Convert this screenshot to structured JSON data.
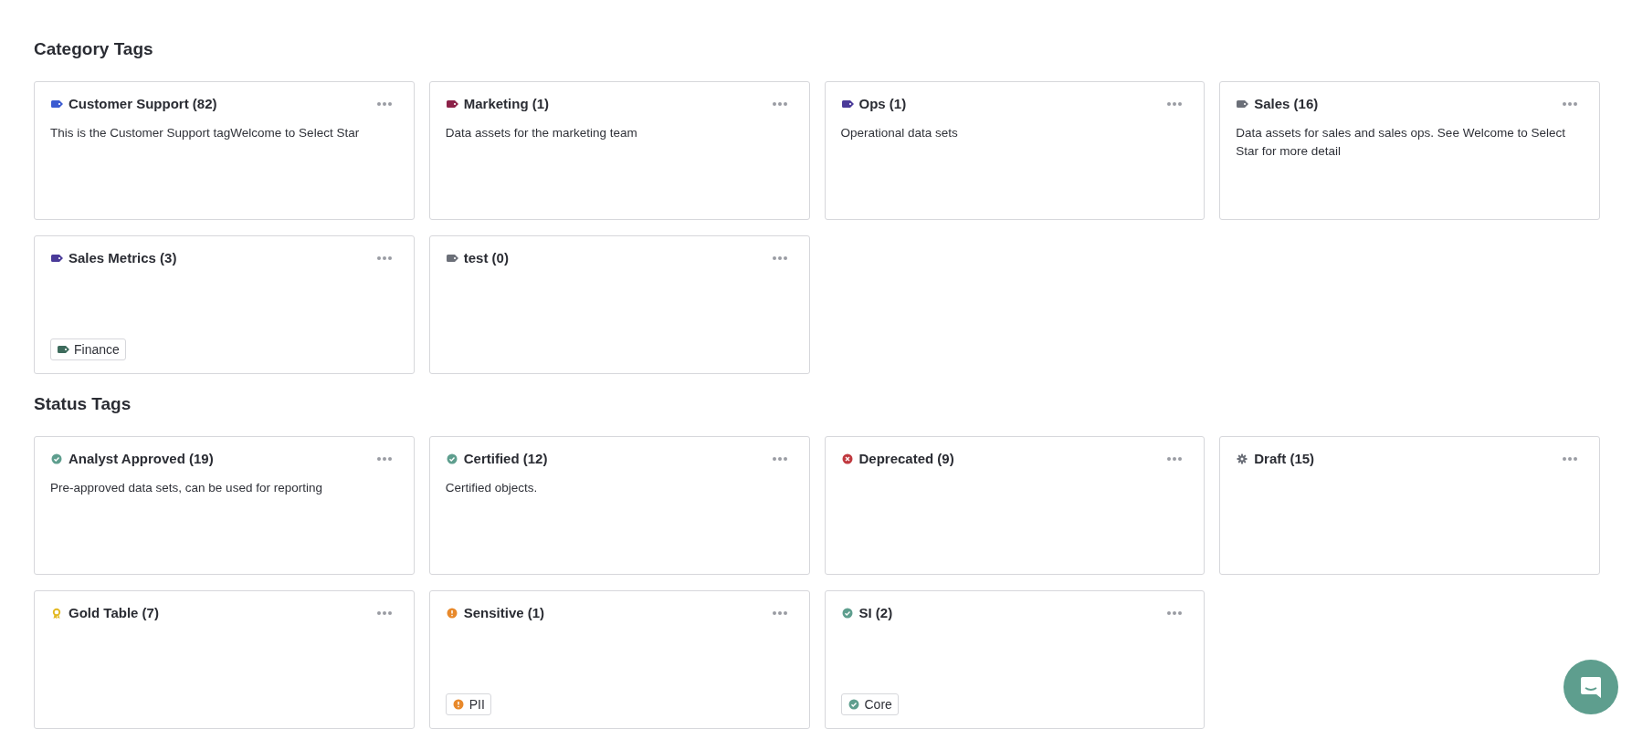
{
  "sections": [
    {
      "title": "Category Tags",
      "cards": [
        {
          "name": "Customer Support (82)",
          "kind": "tag",
          "color": "#3b5bd1",
          "description": "This is the Customer Support tagWelcome to Select Star"
        },
        {
          "name": "Marketing (1)",
          "kind": "tag",
          "color": "#8c2148",
          "description": "Data assets for the marketing team"
        },
        {
          "name": "Ops (1)",
          "kind": "tag",
          "color": "#4a3a99",
          "description": "Operational data sets"
        },
        {
          "name": "Sales (16)",
          "kind": "tag",
          "color": "#6b6f78",
          "description": "Data assets for sales and sales ops. See Welcome to Select Star for more detail"
        },
        {
          "name": "Sales Metrics (3)",
          "kind": "tag",
          "color": "#4a3a99",
          "subtags": [
            {
              "label": "Finance",
              "kind": "tag",
              "color": "#3d6b5c"
            }
          ]
        },
        {
          "name": "test (0)",
          "kind": "tag",
          "color": "#6b6f78"
        }
      ]
    },
    {
      "title": "Status Tags",
      "cards": [
        {
          "name": "Analyst Approved (19)",
          "kind": "check",
          "color": "#5e9e8e",
          "description": "Pre-approved data sets, can be used for reporting"
        },
        {
          "name": "Certified (12)",
          "kind": "check",
          "color": "#5e9e8e",
          "description": "Certified objects."
        },
        {
          "name": "Deprecated (9)",
          "kind": "cross",
          "color": "#c0393f"
        },
        {
          "name": "Draft (15)",
          "kind": "gear",
          "color": "#6b6f78"
        },
        {
          "name": "Gold Table (7)",
          "kind": "award",
          "color": "#e3b924"
        },
        {
          "name": "Sensitive (1)",
          "kind": "alert",
          "color": "#e8892b",
          "subtags": [
            {
              "label": "PII",
              "kind": "alert",
              "color": "#e8892b"
            }
          ]
        },
        {
          "name": "SI (2)",
          "kind": "check",
          "color": "#5e9e8e",
          "subtags": [
            {
              "label": "Core",
              "kind": "check",
              "color": "#5e9e8e"
            }
          ]
        }
      ]
    }
  ]
}
